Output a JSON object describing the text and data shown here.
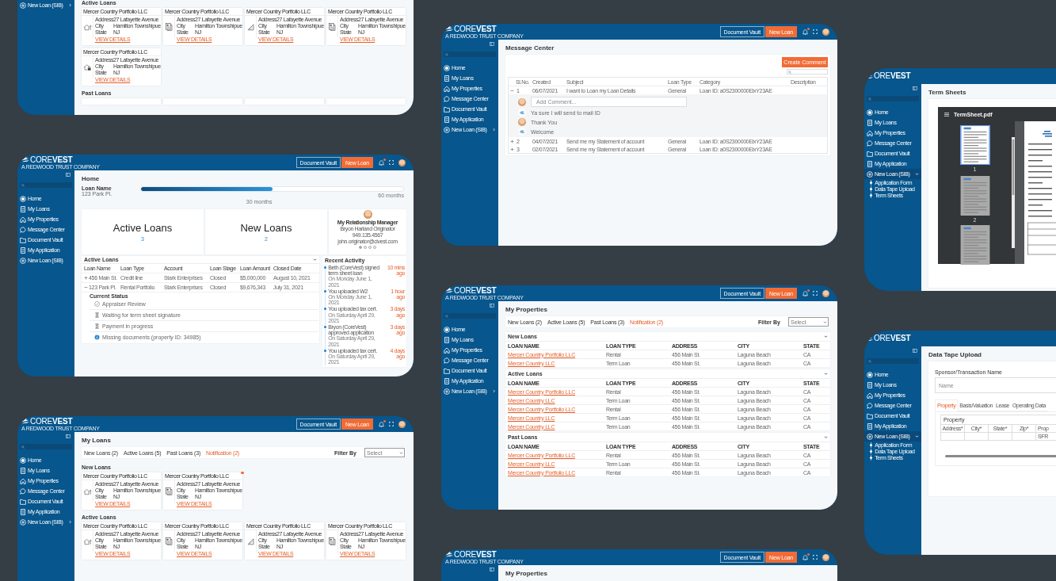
{
  "screens": [
    {
      "kind": "my_loans",
      "sidebar": {
        "items": [
          {
            "label": "New Loan (SIB)",
            "kind": "new",
            "expanded": false
          }
        ]
      },
      "content": {
        "sections": [
          {
            "title": "Active Loans",
            "cards": [
              {
                "title": "Mercer Country Portfolio LLC",
                "kind": "house",
                "fields": [
                  [
                    "Address",
                    "27 Lafayette Avenue"
                  ],
                  [
                    "City",
                    "Hamilton Townshipue"
                  ],
                  [
                    "State",
                    "NJ"
                  ]
                ],
                "link": "VIEW DETAILS"
              },
              {
                "title": "Mercer Country Portfolio LLC",
                "kind": "doc",
                "fields": [
                  [
                    "Address",
                    "27 Lafayette Avenue"
                  ],
                  [
                    "City",
                    "Hamilton Townshipue"
                  ],
                  [
                    "State",
                    "NJ"
                  ]
                ],
                "link": "VIEW DETAILS"
              },
              {
                "title": "Mercer Country Portfolio LLC",
                "kind": "ruler",
                "fields": [
                  [
                    "Address",
                    "27 Lafayette Avenue"
                  ],
                  [
                    "City",
                    "Hamilton Townshipue"
                  ],
                  [
                    "State",
                    "NJ"
                  ]
                ],
                "link": "VIEW DETAILS"
              },
              {
                "title": "Mercer Country Portfolio LLC",
                "kind": "doc",
                "fields": [
                  [
                    "Address",
                    "27 Lafayette Avenue"
                  ],
                  [
                    "City",
                    "Hamilton Townshipue"
                  ],
                  [
                    "State",
                    "NJ"
                  ]
                ],
                "link": "VIEW DETAILS"
              },
              {
                "title": "Mercer Country Portfolio LLC",
                "kind": "house_lock",
                "fields": [
                  [
                    "Address",
                    "27 Lafayette Avenue"
                  ],
                  [
                    "City",
                    "Hamilton Townshipue"
                  ],
                  [
                    "State",
                    "NJ"
                  ]
                ],
                "link": "VIEW DETAILS"
              }
            ]
          },
          {
            "title": "Past Loans",
            "cards": [
              {
                "kind": "cut"
              },
              {
                "kind": "cut"
              },
              {
                "kind": "cut"
              },
              {
                "kind": "cut"
              }
            ]
          }
        ]
      }
    },
    {
      "kind": "home",
      "header": {
        "logo": "CORE**VEST**",
        "tagline": "A REDWOOD TRUST COMPANY",
        "buttons": [
          {
            "label": "Document Vault",
            "kind": "outline"
          },
          {
            "label": "New Loan",
            "kind": "primary"
          }
        ],
        "tools": true
      },
      "sidebar": {
        "collapse": true,
        "search": true,
        "items": [
          {
            "label": "Home",
            "kind": "home"
          },
          {
            "label": "My Loans",
            "kind": "loans"
          },
          {
            "label": "My Properties",
            "kind": "properties"
          },
          {
            "label": "Message Center",
            "kind": "message"
          },
          {
            "label": "Document Vault",
            "kind": "vault"
          },
          {
            "label": "My Application",
            "kind": "application"
          },
          {
            "label": "New Loan (SIB)",
            "kind": "new"
          }
        ]
      },
      "content": {
        "title": "Home",
        "loan": {
          "label": "Loan Name",
          "value": "123 Park Pl."
        },
        "progress": {
          "level": 0.5,
          "mid_label": "30 months",
          "end_label": "60 months"
        },
        "stats": [
          {
            "title": "Active Loans",
            "value": "3"
          },
          {
            "title": "New Loans",
            "value": "2"
          }
        ],
        "manager": {
          "title": "My Relationship Manager",
          "lines": [
            "Bryon Harland Originator",
            "949.135.4567",
            "john.originator@civest.com"
          ],
          "dots": [
            {
              "selected": true
            },
            {
              "selected": false
            },
            {
              "selected": false
            },
            {
              "selected": false
            }
          ]
        },
        "table": {
          "title": "Active Loans",
          "columns": [
            "Loan Name",
            "Loan Type",
            "Account",
            "Loan Stage",
            "Loan Amount",
            "Closed Date"
          ],
          "rows": [
            {
              "cells": [
                "456 Main St.",
                "Credit line",
                "Stark Enterprises",
                "Closed",
                "$5,000,000",
                "August 10, 2021"
              ],
              "expanded": false
            },
            {
              "cells": [
                "123 Park Pl.",
                "Rental Portfolio",
                "Stark Enterprises",
                "Closed",
                "$9,676,343",
                "July 31, 2021"
              ],
              "expanded": true,
              "status": {
                "title": "Current Status",
                "items": [
                  {
                    "kind": "done",
                    "text": "Appraiser Review"
                  },
                  {
                    "kind": "waiting",
                    "text": "Waiting for term sheet signature"
                  },
                  {
                    "kind": "waiting",
                    "text": "Payment in progress"
                  },
                  {
                    "kind": "info",
                    "text": "Missing documents (property ID: 34985)"
                  }
                ]
              }
            }
          ]
        },
        "activity": {
          "title": "Recent Activity",
          "items": [
            {
              "text": "Beth (CoreVest) signed term sheet loan",
              "date": "On Monday June 1, 2021",
              "ago": "10 mins ago"
            },
            {
              "text": "You uploaded W2",
              "date": "On Monday June 1, 2021",
              "ago": "1 hour ago"
            },
            {
              "text": "You uploaded tax cert.",
              "date": "On Saturday April 29, 2021",
              "ago": "3 days ago"
            },
            {
              "text": "Bryon (CoreVest) approved application",
              "date": "On Saturday April 29, 2021",
              "ago": "3 days ago"
            },
            {
              "text": "You uploaded tax cert.",
              "date": "On Saturday April 29, 2021",
              "ago": "4 days ago"
            }
          ]
        }
      }
    },
    {
      "kind": "my_loans",
      "header": {
        "logo": "CORE**VEST**",
        "tagline": "A REDWOOD TRUST COMPANY",
        "buttons": [
          {
            "label": "Document Vault",
            "kind": "outline"
          },
          {
            "label": "New Loan",
            "kind": "primary"
          }
        ],
        "tools": true
      },
      "sidebar": {
        "collapse": true,
        "search": true,
        "items": [
          {
            "label": "Home",
            "kind": "home"
          },
          {
            "label": "My Loans",
            "kind": "loans"
          },
          {
            "label": "My Properties",
            "kind": "properties"
          },
          {
            "label": "Message Center",
            "kind": "message"
          },
          {
            "label": "Document Vault",
            "kind": "vault"
          },
          {
            "label": "My Application",
            "kind": "application"
          },
          {
            "label": "New Loan (SIB)",
            "kind": "new",
            "expanded": false
          }
        ]
      },
      "content": {
        "title": "My Loans",
        "tabs": [
          {
            "label": "New Loans (2)",
            "selected": false
          },
          {
            "label": "Active Loans (5)",
            "selected": false
          },
          {
            "label": "Past Loans (3)",
            "selected": false
          },
          {
            "label": "Notification (2)",
            "selected": true
          }
        ],
        "filter": {
          "label": "Filter By",
          "placeholder": "Select"
        },
        "sections": [
          {
            "title": "New Loans",
            "cards": [
              {
                "title": "Mercer Country Portfolio LLC",
                "kind": "house",
                "unread": false,
                "fields": [
                  [
                    "Address",
                    "27 Lafayette Avenue"
                  ],
                  [
                    "City",
                    "Hamilton Townshipue"
                  ],
                  [
                    "State",
                    "NJ"
                  ]
                ],
                "link": "VIEW DETAILS"
              },
              {
                "title": "Mercer Country Portfolio LLC",
                "kind": "doc",
                "unread": true,
                "fields": [
                  [
                    "Address",
                    "27 Lafayette Avenue"
                  ],
                  [
                    "City",
                    "Hamilton Townshipue"
                  ],
                  [
                    "State",
                    "NJ"
                  ]
                ],
                "link": "VIEW DETAILS"
              }
            ]
          },
          {
            "title": "Active Loans",
            "cards": [
              {
                "title": "Mercer Country Portfolio LLC",
                "kind": "house",
                "unread": false,
                "fields": [
                  [
                    "Address",
                    "27 Lafayette Avenue"
                  ],
                  [
                    "City",
                    "Hamilton Townshipue"
                  ],
                  [
                    "State",
                    "NJ"
                  ]
                ],
                "link": "VIEW DETAILS"
              },
              {
                "title": "Mercer Country Portfolio LLC",
                "kind": "doc",
                "unread": false,
                "fields": [
                  [
                    "Address",
                    "27 Lafayette Avenue"
                  ],
                  [
                    "City",
                    "Hamilton Townshipue"
                  ],
                  [
                    "State",
                    "NJ"
                  ]
                ],
                "link": "VIEW DETAILS"
              },
              {
                "title": "Mercer Country Portfolio LLC",
                "kind": "ruler",
                "unread": false,
                "fields": [
                  [
                    "Address",
                    "27 Lafayette Avenue"
                  ],
                  [
                    "City",
                    "Hamilton Townshipue"
                  ],
                  [
                    "State",
                    "NJ"
                  ]
                ],
                "link": "VIEW DETAILS"
              },
              {
                "title": "Mercer Country Portfolio LLC",
                "kind": "doc",
                "unread": false,
                "fields": [
                  [
                    "Address",
                    "27 Lafayette Avenue"
                  ],
                  [
                    "City",
                    "Hamilton Townshipue"
                  ],
                  [
                    "State",
                    "NJ"
                  ]
                ],
                "link": "VIEW DETAILS"
              }
            ]
          }
        ]
      }
    },
    {
      "kind": "message_center",
      "header": {
        "logo": "CORE**VEST**",
        "tagline": "A REDWOOD TRUST COMPANY",
        "buttons": [
          {
            "label": "Document Vault",
            "kind": "outline"
          },
          {
            "label": "New Loan",
            "kind": "primary"
          }
        ],
        "tools": true
      },
      "sidebar": {
        "collapse": true,
        "search": true,
        "items": [
          {
            "label": "Home",
            "kind": "home"
          },
          {
            "label": "My Loans",
            "kind": "loans"
          },
          {
            "label": "My Properties",
            "kind": "properties"
          },
          {
            "label": "Message Center",
            "kind": "message"
          },
          {
            "label": "Document Vault",
            "kind": "vault"
          },
          {
            "label": "My Application",
            "kind": "application"
          },
          {
            "label": "New Loan (SIB)",
            "kind": "new",
            "expanded": false
          }
        ]
      },
      "content": {
        "title": "Message Center",
        "button": "Create Comment",
        "columns": [
          "Sl.No.",
          "Created",
          "Subject",
          "Loan Type",
          "Category",
          "Description"
        ],
        "rows": [
          {
            "cells": [
              "1",
              "06/07/2021",
              "I want to Loan my Loan Details",
              "General",
              "Loan ID: a0S2300000ElxY23AE"
            ],
            "expanded": true,
            "thread": [
              {
                "kind": "input",
                "placeholder": "Add Comment..."
              },
              {
                "kind": "company",
                "text": "Ya sure I will send to mail ID"
              },
              {
                "kind": "user",
                "text": "Thank You"
              },
              {
                "kind": "company",
                "text": "Welcome"
              }
            ]
          },
          {
            "cells": [
              "2",
              "04/07/2021",
              "Send me my Statement of account",
              "General",
              "Loan ID: a0S2300000ElxY23AE"
            ],
            "expanded": false
          },
          {
            "cells": [
              "3",
              "02/07/2021",
              "Send me my Statement of account",
              "General",
              "Loan ID: a0S2300000ElxY23AE"
            ],
            "expanded": false
          }
        ]
      }
    },
    {
      "kind": "my_properties",
      "header": {
        "logo": "CORE**VEST**",
        "tagline": "A REDWOOD TRUST COMPANY",
        "buttons": [
          {
            "label": "Document Vault",
            "kind": "outline"
          },
          {
            "label": "New Loan",
            "kind": "primary"
          }
        ],
        "tools": true
      },
      "sidebar": {
        "collapse": true,
        "search": true,
        "items": [
          {
            "label": "Home",
            "kind": "home"
          },
          {
            "label": "My Loans",
            "kind": "loans"
          },
          {
            "label": "My Properties",
            "kind": "properties"
          },
          {
            "label": "Message Center",
            "kind": "message"
          },
          {
            "label": "Document Vault",
            "kind": "vault"
          },
          {
            "label": "My Application",
            "kind": "application"
          },
          {
            "label": "New Loan (SIB)",
            "kind": "new",
            "expanded": false
          }
        ]
      },
      "content": {
        "title": "My Properties",
        "tabs": [
          {
            "label": "New Loans (2)",
            "selected": false
          },
          {
            "label": "Active Loans (5)",
            "selected": false
          },
          {
            "label": "Past Loans (3)",
            "selected": false
          },
          {
            "label": "Notification (2)",
            "selected": true
          }
        ],
        "filter": {
          "label": "Filter By",
          "placeholder": "Select"
        },
        "sections": [
          {
            "title": "New Loans",
            "columns": [
              "LOAN NAME",
              "LOAN TYPE",
              "ADDRESS",
              "CITY",
              "STATE"
            ],
            "rows": [
              [
                "Mercer Country Portfolio LLC",
                "Rental",
                "456 Main St.",
                "Laguna Beach",
                "CA"
              ],
              [
                "Mercer Country LLC",
                "Term Loan",
                "456 Main St.",
                "Laguna Beach",
                "CA"
              ]
            ]
          },
          {
            "title": "Active Loans",
            "columns": [
              "LOAN NAME",
              "LOAN TYPE",
              "ADDRESS",
              "CITY",
              "STATE"
            ],
            "rows": [
              [
                "Mercer Country Portfolio LLC",
                "Rental",
                "456 Main St.",
                "Laguna Beach",
                "CA"
              ],
              [
                "Mercer Country LLC",
                "Term Loan",
                "456 Main St.",
                "Laguna Beach",
                "CA"
              ],
              [
                "Mercer Country Portfolio LLC",
                "Rental",
                "456 Main St.",
                "Laguna Beach",
                "CA"
              ],
              [
                "Mercer Country LLC",
                "Term Loan",
                "456 Main St.",
                "Laguna Beach",
                "CA"
              ],
              [
                "Mercer Country LLC",
                "Term Loan",
                "456 Main St.",
                "Laguna Beach",
                "CA"
              ]
            ]
          },
          {
            "title": "Past Loans",
            "columns": [
              "LOAN NAME",
              "LOAN TYPE",
              "ADDRESS",
              "CITY",
              "STATE"
            ],
            "rows": [
              [
                "Mercer Country Portfolio LLC",
                "Rental",
                "456 Main St.",
                "Laguna Beach",
                "CA"
              ],
              [
                "Mercer Country LLC",
                "Term Loan",
                "456 Main St.",
                "Laguna Beach",
                "CA"
              ],
              [
                "Mercer Country Portfolio LLC",
                "Rental",
                "456 Main St.",
                "Laguna Beach",
                "CA"
              ]
            ]
          }
        ]
      }
    },
    {
      "kind": "my_properties",
      "header": {
        "logo": "CORE**VEST**",
        "tagline": "A REDWOOD TRUST COMPANY",
        "buttons": [
          {
            "label": "Document Vault",
            "kind": "outline"
          },
          {
            "label": "New Loan",
            "kind": "primary"
          }
        ],
        "tools": true
      },
      "sidebar": {
        "collapse": true
      },
      "content": {
        "title": "My Properties"
      }
    },
    {
      "kind": "term_sheets",
      "header": {
        "logo": "ORE**VEST**"
      },
      "sidebar": {
        "collapse": true,
        "search": true,
        "items": [
          {
            "label": "Home",
            "kind": "home"
          },
          {
            "label": "My Loans",
            "kind": "loans"
          },
          {
            "label": "My Properties",
            "kind": "properties"
          },
          {
            "label": "Message Center",
            "kind": "message"
          },
          {
            "label": "Document Vault",
            "kind": "vault"
          },
          {
            "label": "My Application",
            "kind": "application"
          },
          {
            "label": "New Loan (SIB)",
            "kind": "new",
            "expanded": true,
            "children": [
              {
                "label": "Application Form"
              },
              {
                "label": "Data Tape Upload"
              },
              {
                "label": "Term Sheets"
              }
            ]
          }
        ]
      },
      "content": {
        "title": "Term Sheets",
        "file": "TermSheet.pdf",
        "pages": [
          {
            "number": "1",
            "selected": true
          },
          {
            "number": "2",
            "selected": false
          },
          {
            "selected": false
          }
        ]
      }
    },
    {
      "kind": "data_tape",
      "header": {
        "logo": "ORE**VEST**"
      },
      "sidebar": {
        "collapse": true,
        "search": true,
        "items": [
          {
            "label": "Home",
            "kind": "home"
          },
          {
            "label": "My Loans",
            "kind": "loans"
          },
          {
            "label": "My Properties",
            "kind": "properties"
          },
          {
            "label": "Message Center",
            "kind": "message"
          },
          {
            "label": "Document Vault",
            "kind": "vault"
          },
          {
            "label": "My Application",
            "kind": "application"
          },
          {
            "label": "New Loan (SIB)",
            "kind": "new",
            "expanded": true,
            "children": [
              {
                "label": "Application Form"
              },
              {
                "label": "Data Tape Upload"
              },
              {
                "label": "Term Sheets"
              }
            ]
          }
        ]
      },
      "content": {
        "title": "Data Tape Upload",
        "field": {
          "label": "Sponsor/Transaction Name",
          "placeholder": "Name"
        },
        "tabs": [
          {
            "label": "Property",
            "selected": true
          },
          {
            "label": "Basis/Valuation",
            "selected": false
          },
          {
            "label": "Lease",
            "selected": false
          },
          {
            "label": "Operating Data",
            "selected": false
          }
        ],
        "table": {
          "title": "Property",
          "columns": [
            "Address*",
            "City*",
            "State*",
            "Zip*",
            "Prop"
          ],
          "row": {
            "column_5": "SFR"
          }
        }
      }
    }
  ]
}
